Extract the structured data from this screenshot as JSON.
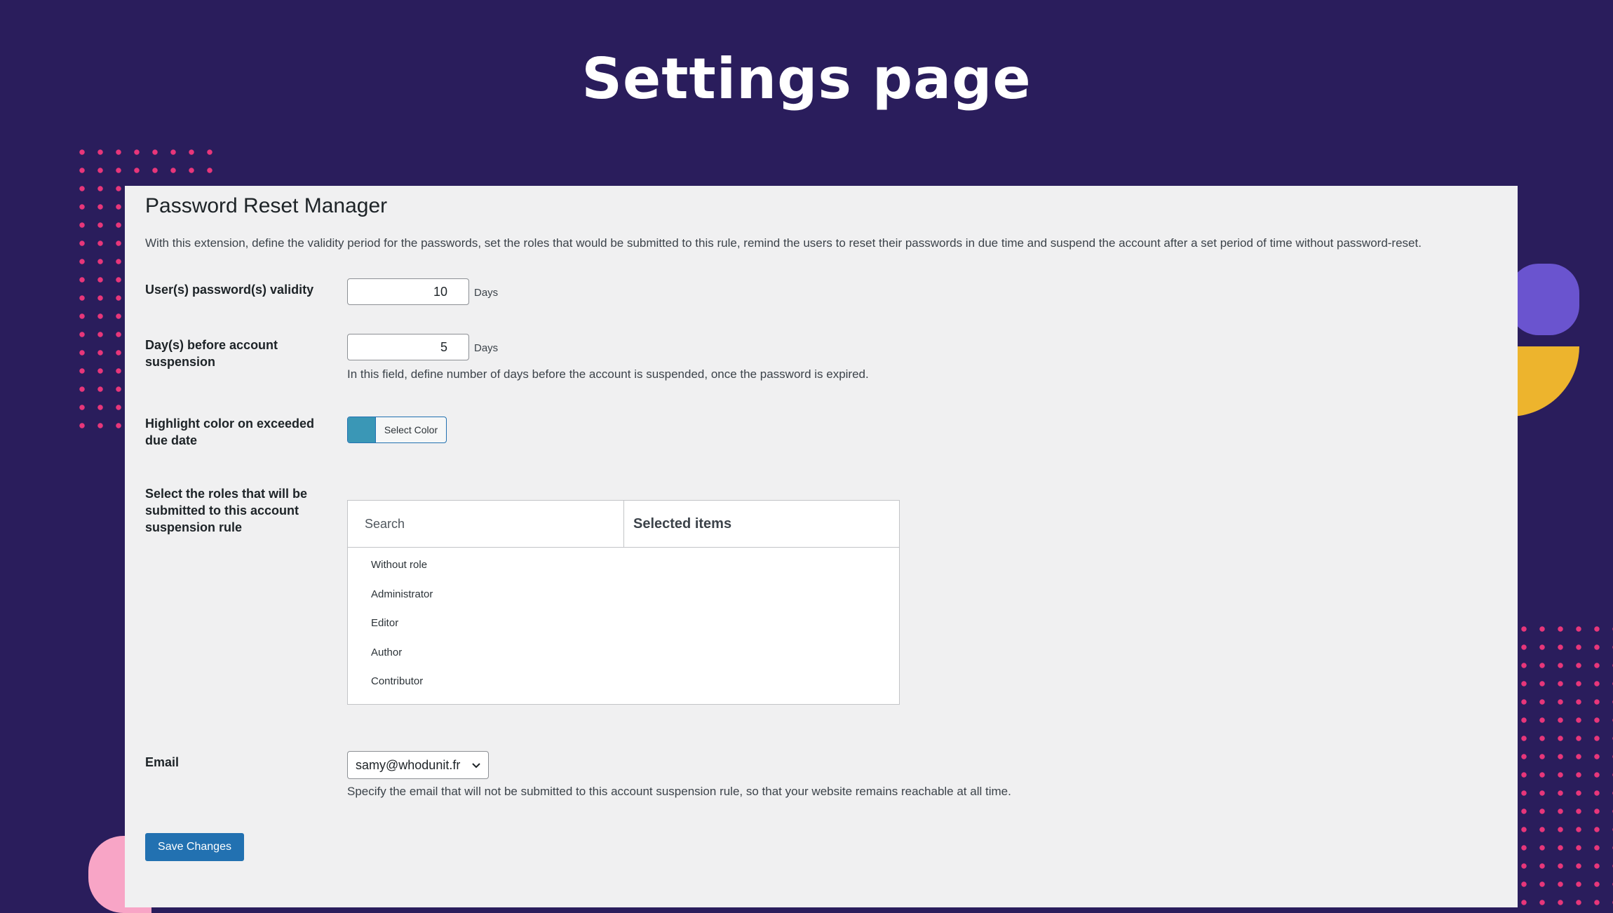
{
  "hero": {
    "title": "Settings page"
  },
  "colors": {
    "background": "#2a1d5c",
    "accent_pink": "#e8367a",
    "shape_purple": "#6a54cf",
    "shape_yellow": "#edb42d",
    "panel": "#f0f0f1",
    "button_primary": "#2271b1",
    "highlight_color": "#3a97b6"
  },
  "panel": {
    "title": "Password Reset Manager",
    "intro": "With this extension, define the validity period for the passwords, set the roles that would be submitted to this rule, remind the users to reset their passwords in due time and suspend the account after a set period of time without password-reset."
  },
  "validity": {
    "label": "User(s) password(s) validity",
    "value": "10",
    "unit": "Days"
  },
  "suspension": {
    "label": "Day(s) before account suspension",
    "value": "5",
    "unit": "Days",
    "description": "In this field, define number of days before the account is suspended, once the password is expired."
  },
  "highlight": {
    "label": "Highlight color on exceeded due date",
    "button_label": "Select Color"
  },
  "roles": {
    "label": "Select the roles that will be submitted to this account suspension rule",
    "search_placeholder": "Search",
    "selected_header": "Selected items",
    "items": [
      "Without role",
      "Administrator",
      "Editor",
      "Author",
      "Contributor"
    ]
  },
  "email": {
    "label": "Email",
    "selected": "samy@whodunit.fr",
    "description": "Specify the email that will not be submitted to this account suspension rule, so that your website remains reachable at all time."
  },
  "actions": {
    "save_label": "Save Changes"
  }
}
